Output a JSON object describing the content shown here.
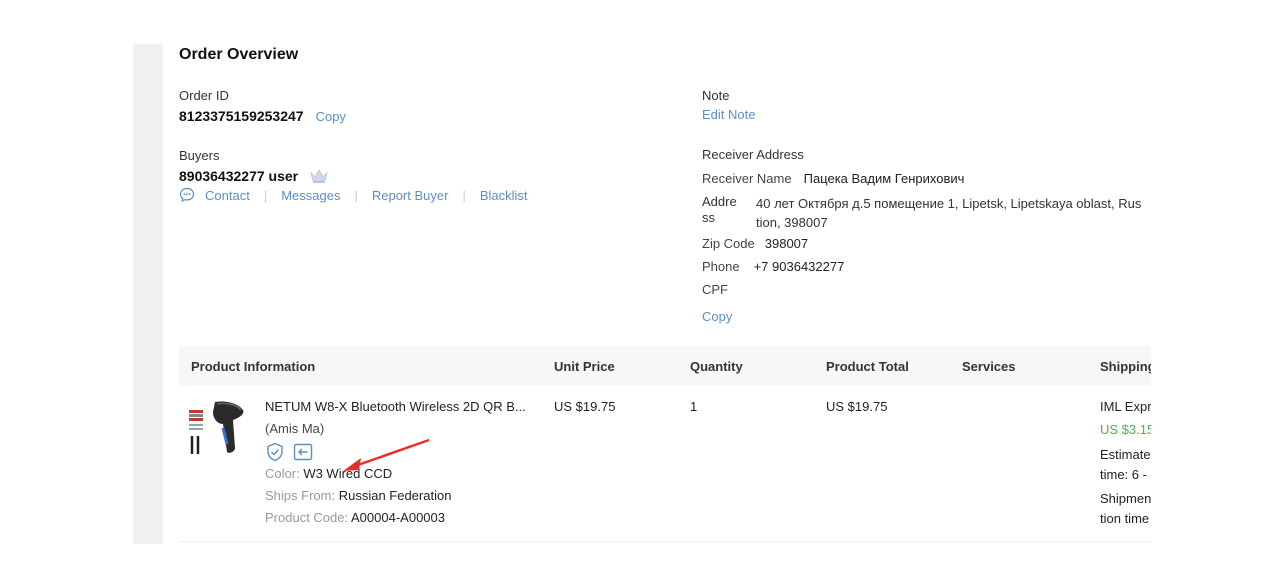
{
  "title": "Order Overview",
  "order": {
    "id_label": "Order ID",
    "id_value": "8123375159253247",
    "copy_label": "Copy"
  },
  "buyer": {
    "label": "Buyers",
    "name": "89036432277 user",
    "actions": [
      "Contact",
      "Messages",
      "Report Buyer",
      "Blacklist"
    ]
  },
  "note": {
    "label": "Note",
    "edit_label": "Edit Note"
  },
  "receiver": {
    "title": "Receiver Address",
    "name_label": "Receiver Name",
    "name_value": "Пацека Вадим Генрихович",
    "address_label_1": "Addre",
    "address_label_2": "ss",
    "address_value_1": "40 лет Октября д.5 помещение 1, Lipetsk, Lipetskaya oblast, Rus",
    "address_value_2": "tion, 398007",
    "zip_label": "Zip Code",
    "zip_value": "398007",
    "phone_label": "Phone",
    "phone_value": "+7 9036432277",
    "cpf_label": "CPF",
    "copy_label": "Copy"
  },
  "table": {
    "headers": [
      "Product Information",
      "Unit Price",
      "Quantity",
      "Product Total",
      "Services",
      "Shipping"
    ],
    "row": {
      "product_name": "NETUM W8-X Bluetooth Wireless 2D QR B...",
      "seller": "(Amis Ma)",
      "color_label": "Color:",
      "color_value": "W3 Wired CCD",
      "ships_label": "Ships From:",
      "ships_value": "Russian Federation",
      "code_label": "Product Code:",
      "code_value": "A00004-A00003",
      "unit_price": "US $19.75",
      "quantity": "1",
      "product_total": "US $19.75",
      "shipping_method": "IML Expr",
      "shipping_price": "US $3.15",
      "estimate_1": "Estimate",
      "estimate_2": "time: 6 -",
      "shipment_1": "Shipmen",
      "shipment_2": "tion time"
    }
  },
  "icons": [
    "crown-icon",
    "chat-icon",
    "shield-check-icon",
    "return-icon",
    "annotation-arrow"
  ],
  "colors": {
    "link": "#5b8fc2",
    "price_green": "#4caf50",
    "arrow": "#e8302a"
  }
}
